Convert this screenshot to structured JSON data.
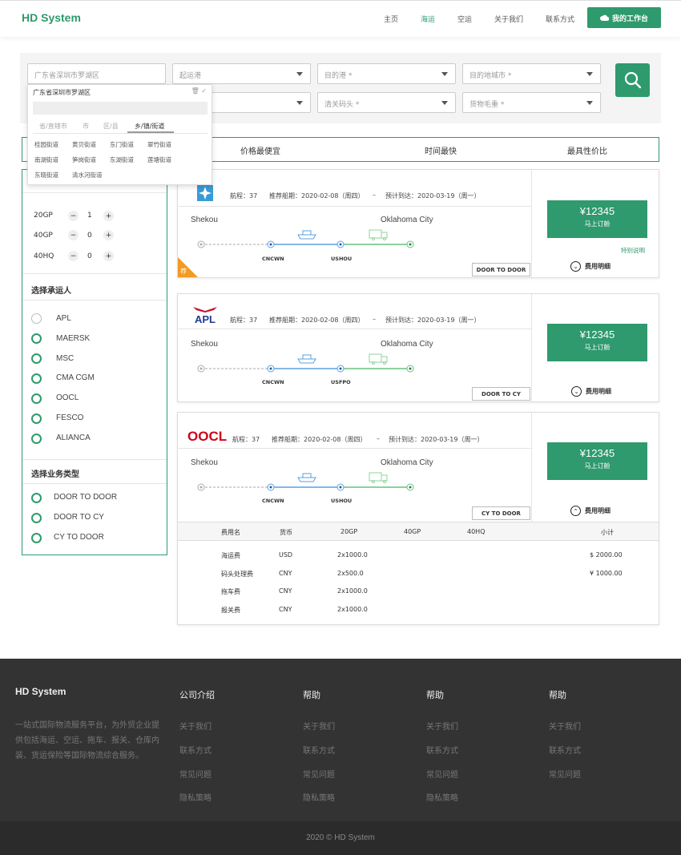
{
  "header": {
    "logo": "HD System",
    "nav": [
      "主页",
      "海运",
      "空运",
      "关于我们",
      "联系方式"
    ],
    "active_nav": "海运",
    "workbench": "我的工作台"
  },
  "search": {
    "origin_city": "广东省深圳市罗湖区",
    "origin_port": "起运港",
    "dest_port": "目的港 *",
    "dest_city": "目的地城市 *",
    "clear_port": "清关码头 *",
    "cargo_weight": "货物毛重 *"
  },
  "dropdown": {
    "title": "广东省深圳市罗湖区",
    "tabs": [
      "省/直辖市",
      "市",
      "区/县",
      "乡/镇/街道"
    ],
    "items": [
      "桂园街道",
      "黄贝街道",
      "东门街道",
      "翠竹街道",
      "南湖街道",
      "笋岗街道",
      "东湖街道",
      "莲塘街道",
      "东晓街道",
      "清水河街道"
    ]
  },
  "sort": [
    "价格最便宜",
    "时间最快",
    "最具性价比"
  ],
  "sidebar": {
    "containers": [
      {
        "label": "20GP",
        "value": "1"
      },
      {
        "label": "40GP",
        "value": "0"
      },
      {
        "label": "40HQ",
        "value": "0"
      }
    ],
    "carrier_title": "选择承运人",
    "carriers": [
      "APL",
      "MAERSK",
      "MSC",
      "CMA CGM",
      "OOCL",
      "FESCO",
      "ALIANCA"
    ],
    "service_title": "选择业务类型",
    "services": [
      "DOOR TO DOOR",
      "DOOR TO CY",
      "CY TO DOOR"
    ]
  },
  "cards": [
    {
      "voyage": "航程：37",
      "sail": "推荐船期：2020-02-08（周四）",
      "dash": "–",
      "arrive": "预计到达：2020-03-19（周一）",
      "from": "Shekou",
      "to": "Oklahoma City",
      "port1": "CNCWN",
      "port2": "USHOU",
      "service": "DOOR TO DOOR",
      "price": "¥12345",
      "book": "马上订舱",
      "special": "特别说明",
      "fee": "费用明细",
      "badge": "荐"
    },
    {
      "carrier": "APL",
      "voyage": "航程：37",
      "sail": "推荐船期：2020-02-08（周四）",
      "dash": "–",
      "arrive": "预计到达：2020-03-19（周一）",
      "from": "Shekou",
      "to": "Oklahoma City",
      "port1": "CNCWN",
      "port2": "USFPO",
      "service": "DOOR TO CY",
      "price": "¥12345",
      "book": "马上订舱",
      "fee": "费用明细"
    },
    {
      "carrier": "OOCL",
      "voyage": "航程：37",
      "sail": "推荐船期：2020-02-08（周四）",
      "dash": "–",
      "arrive": "预计到达：2020-03-19（周一）",
      "from": "Shekou",
      "to": "Oklahoma City",
      "port1": "CNCWN",
      "port2": "USHOU",
      "service": "CY TO DOOR",
      "price": "¥12345",
      "book": "马上订舱",
      "fee": "费用明细"
    }
  ],
  "fee_table": {
    "headers": [
      "费用名",
      "货币",
      "20GP",
      "40GP",
      "40HQ",
      "小计"
    ],
    "rows": [
      {
        "name": "海运费",
        "currency": "USD",
        "gp20": "2x1000.0",
        "total": "$ 2000.00"
      },
      {
        "name": "码头处理费",
        "currency": "CNY",
        "gp20": "2x500.0",
        "total": "¥ 1000.00"
      },
      {
        "name": "拖车费",
        "currency": "CNY",
        "gp20": "2x1000.0",
        "total": ""
      },
      {
        "name": "报关费",
        "currency": "CNY",
        "gp20": "2x1000.0",
        "total": ""
      }
    ]
  },
  "footer": {
    "brand": "HD System",
    "desc": "一站式国际物流服务平台，为外贸企业提供包括海运、空运、拖车、报关、仓库内装、货运保险等国际物流综合服务。",
    "columns": [
      {
        "title": "公司介绍",
        "links": [
          "关于我们",
          "联系方式",
          "常见问题",
          "隐私策略"
        ]
      },
      {
        "title": "帮助",
        "links": [
          "关于我们",
          "联系方式",
          "常见问题",
          "隐私策略"
        ]
      },
      {
        "title": "帮助",
        "links": [
          "关于我们",
          "联系方式",
          "常见问题",
          "隐私策略"
        ]
      },
      {
        "title": "帮助",
        "links": [
          "关于我们",
          "联系方式",
          "常见问题"
        ]
      }
    ],
    "copyright": "2020 © HD System"
  },
  "colors": {
    "brand": "#2e9a6d",
    "badge": "#f39a21",
    "footer": "#333333"
  }
}
